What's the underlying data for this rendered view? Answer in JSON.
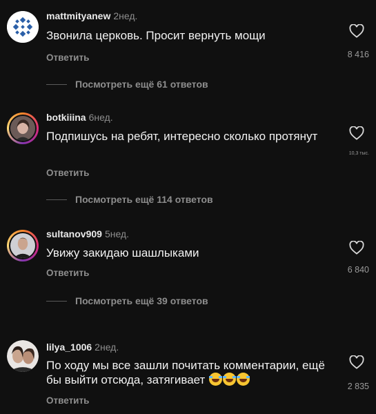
{
  "comments": [
    {
      "username": "mattmityanew",
      "age": "2нед.",
      "text": "Звонила церковь. Просит вернуть мощи",
      "reply_label": "Ответить",
      "likes": "8 416",
      "view_replies": "Посмотреть ещё 61 ответов"
    },
    {
      "username": "botkiiina",
      "age": "6нед.",
      "text": "Подпишусь на ребят, интересно сколько протянут",
      "reply_label": "Ответить",
      "likes": "10,3 тыс.",
      "view_replies": "Посмотреть ещё 114 ответов"
    },
    {
      "username": "sultanov909",
      "age": "5нед.",
      "text": "Увижу закидаю шашлыками",
      "reply_label": "Ответить",
      "likes": "6 840",
      "view_replies": "Посмотреть ещё 39 ответов"
    },
    {
      "username": "lilya_1006",
      "age": "2нед.",
      "text": "По ходу мы все зашли почитать комментарии, ещё бы выйти отсюда,  затягивает",
      "emoji": [
        "face-with-tears-of-joy-icon",
        "face-with-tears-of-joy-icon",
        "face-with-tears-of-joy-icon"
      ],
      "reply_label": "Ответить",
      "likes": "2 835"
    }
  ],
  "colors": {
    "background": "#101010",
    "secondary_text": "#8e8e8e",
    "primary_text": "#f2f2f2"
  }
}
